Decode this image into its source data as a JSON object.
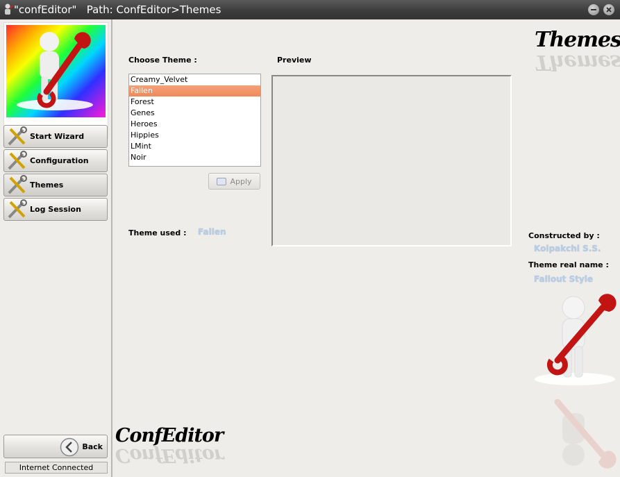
{
  "window": {
    "title": "\"confEditor\"   Path: ConfEditor>Themes"
  },
  "sidebar": {
    "items": [
      {
        "label": "Start Wizard"
      },
      {
        "label": "Configuration"
      },
      {
        "label": "Themes"
      },
      {
        "label": "Log Session"
      }
    ],
    "back_label": "Back",
    "status": "Internet Connected"
  },
  "main": {
    "choose_theme_label": "Choose Theme :",
    "preview_label": "Preview",
    "themes": [
      "Creamy_Velvet",
      "Fallen",
      "Forest",
      "Genes",
      "Heroes",
      "Hippies",
      "LMint",
      "Noir"
    ],
    "selected_theme": "Fallen",
    "apply_label": "Apply",
    "theme_used_label": "Theme used :",
    "theme_used_value": "Fallen",
    "constructed_by_label": "Constructed by :",
    "constructed_by_value": "Kolpakchi S.S.",
    "theme_real_name_label": "Theme real name :",
    "theme_real_name_value": "Fallout Style",
    "page_heading": "Themes",
    "brand": "ConfEditor"
  },
  "colors": {
    "selection": "#ee8a5a",
    "value_text": "#b9cde4",
    "titlebar": "#3d3d3d"
  },
  "icons": [
    "app-icon",
    "minimize-icon",
    "close-icon",
    "tools-icon",
    "back-arrow-icon",
    "apply-icon"
  ]
}
